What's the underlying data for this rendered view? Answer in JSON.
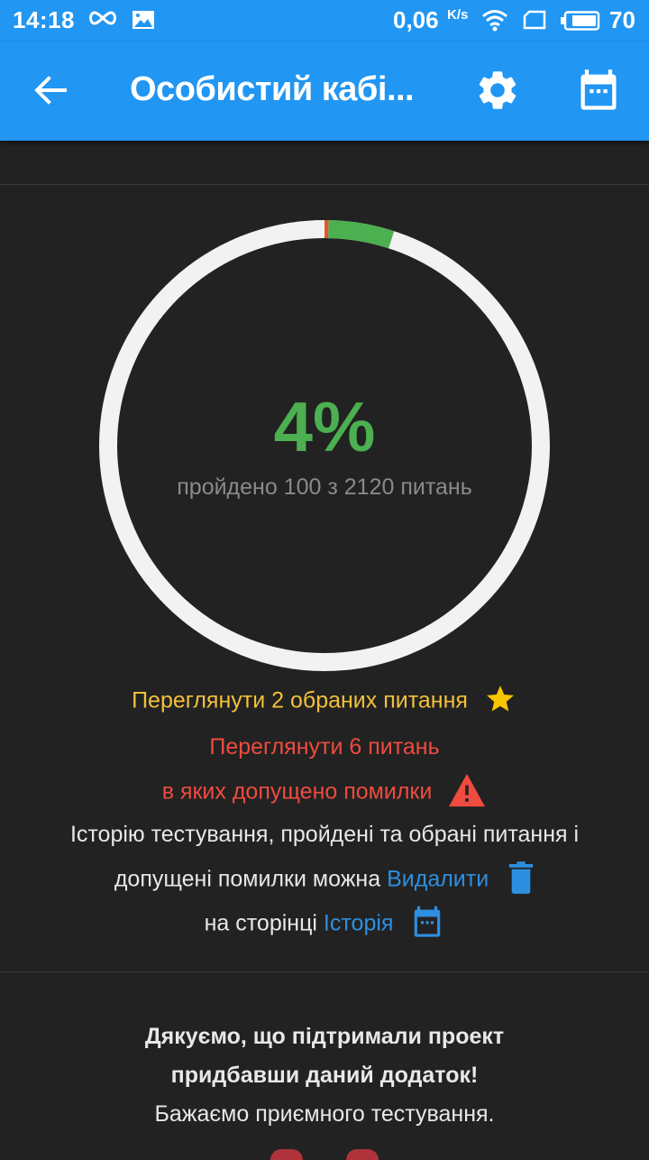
{
  "status_bar": {
    "time": "14:18",
    "net_speed": "0,06",
    "net_speed_unit": "K/s",
    "battery_level": "70",
    "icons": [
      "infinity-icon",
      "image-icon",
      "wifi-icon",
      "sim-icon",
      "battery-icon"
    ]
  },
  "app_bar": {
    "title": "Особистий кабі...",
    "back_icon": "arrow-left-icon",
    "settings_icon": "gear-icon",
    "history_icon": "calendar-icon"
  },
  "progress": {
    "percent_label": "4%",
    "passed_text": "пройдено 100 з 2120 питань",
    "passed": 100,
    "total": 2120,
    "errors": 6,
    "colors": {
      "track": "#F2F2F2",
      "passed": "#4CAF50",
      "errors": "#E8542A"
    }
  },
  "favorites": {
    "text": "Переглянути 2 обраних питання",
    "icon": "star-icon",
    "color": "#F4C03A"
  },
  "mistakes": {
    "line1": "Переглянути 6 питань",
    "line2": "в яких допущено помилки",
    "icon": "warning-icon",
    "color": "#EF4B3F"
  },
  "info": {
    "line1": "Історію тестування, пройдені та обрані питання і",
    "line2_prefix": "допущені помилки можна",
    "delete_link": "Видалити",
    "delete_icon": "trash-icon",
    "line3_prefix": "на сторінці",
    "history_link": "Історія",
    "history_icon": "calendar-icon",
    "link_color": "#2E8FE0"
  },
  "thanks": {
    "line1": "Дякуємо, що підтримали проект",
    "line2": "придбавши даний додаток!",
    "line3": "Бажаємо приємного тестування."
  },
  "colors": {
    "accent": "#2196F3",
    "background": "#222222"
  }
}
